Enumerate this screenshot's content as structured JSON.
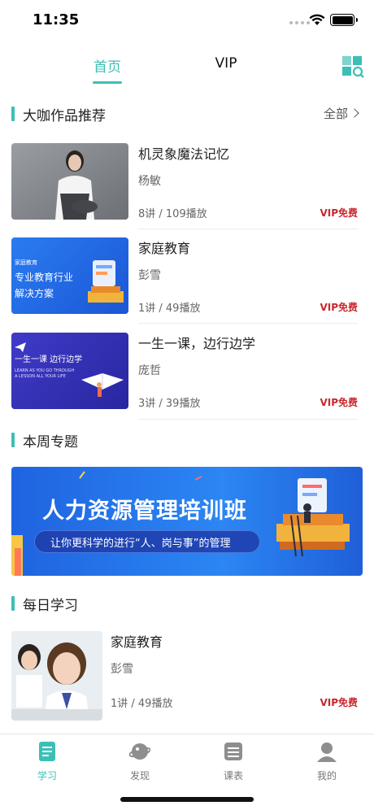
{
  "status_bar": {
    "time": "11:35"
  },
  "top_tabs": [
    {
      "label": "首页",
      "active": true
    },
    {
      "label": "VIP",
      "active": false
    }
  ],
  "featured": {
    "title": "大咖作品推荐",
    "more_label": "全部",
    "courses": [
      {
        "title": "机灵象魔法记忆",
        "author": "杨敏",
        "stats": "8讲 / 109播放",
        "badge": "VIP免费"
      },
      {
        "title": "家庭教育",
        "author": "彭雪",
        "stats": "1讲 / 49播放",
        "badge": "VIP免费",
        "thumb_text": {
          "tag": "家庭教育",
          "line1": "专业教育行业",
          "line2": "解决方案"
        }
      },
      {
        "title": "一生一课，边行边学",
        "author": "庞哲",
        "stats": "3讲 / 39播放",
        "badge": "VIP免费",
        "thumb_text": {
          "line1": "一生一课  边行边学",
          "line2": "LEARN AS YOU GO THROUGH",
          "line3": "A LESSON ALL YOUR LIFE"
        }
      }
    ]
  },
  "weekly": {
    "title": "本周专题",
    "banner": {
      "title": "人力资源管理培训班",
      "subtitle": "让你更科学的进行“人、岗与事”的管理"
    }
  },
  "daily": {
    "title": "每日学习",
    "courses": [
      {
        "title": "家庭教育",
        "author": "彭雪",
        "stats": "1讲 / 49播放",
        "badge": "VIP免费"
      }
    ]
  },
  "bottom_nav": [
    {
      "label": "学习",
      "icon": "notebook-icon",
      "active": true
    },
    {
      "label": "发现",
      "icon": "planet-icon",
      "active": false
    },
    {
      "label": "课表",
      "icon": "schedule-icon",
      "active": false
    },
    {
      "label": "我的",
      "icon": "profile-icon",
      "active": false
    }
  ],
  "colors": {
    "accent": "#3dbfb6",
    "vip_badge": "#c8282e",
    "banner_blue": "#1e5bd8"
  }
}
